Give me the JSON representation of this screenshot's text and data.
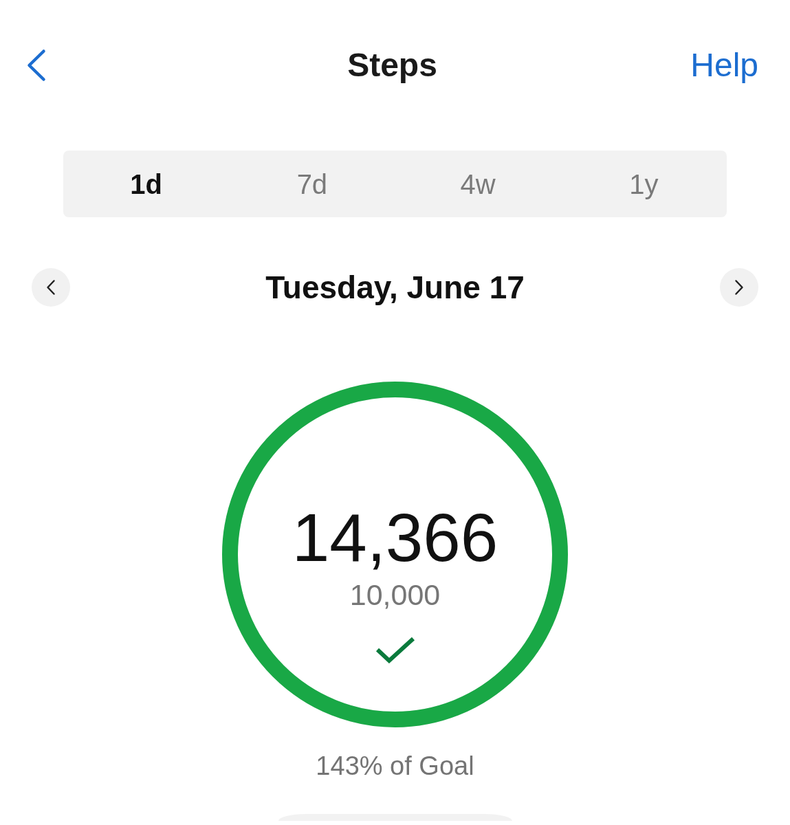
{
  "header": {
    "title": "Steps",
    "help_link": "Help"
  },
  "range_tabs": [
    {
      "label": "1d",
      "selected": true
    },
    {
      "label": "7d",
      "selected": false
    },
    {
      "label": "4w",
      "selected": false
    },
    {
      "label": "1y",
      "selected": false
    }
  ],
  "date_nav": {
    "date": "Tuesday, June 17"
  },
  "ring": {
    "steps": "14,366",
    "goal": "10,000",
    "level": 1,
    "goal_met": true
  },
  "goal_percent": "143% of Goal"
}
